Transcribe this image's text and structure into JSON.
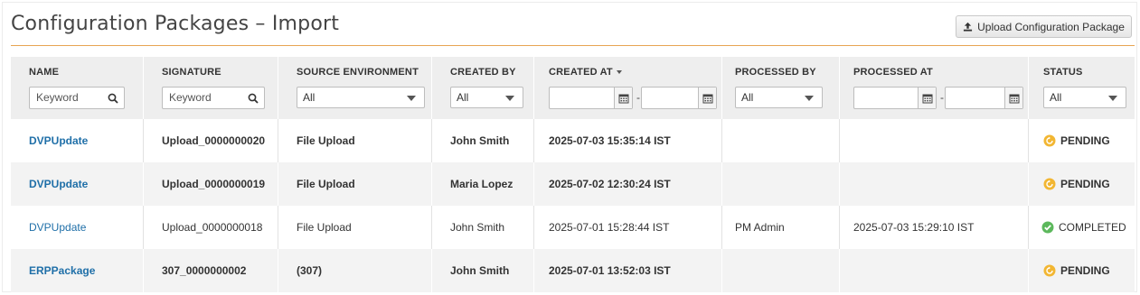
{
  "page": {
    "title": "Configuration Packages – Import",
    "upload_button_label": "Upload Configuration Package"
  },
  "columns": [
    {
      "label": "NAME"
    },
    {
      "label": "SIGNATURE"
    },
    {
      "label": "SOURCE ENVIRONMENT"
    },
    {
      "label": "CREATED BY"
    },
    {
      "label": "CREATED AT"
    },
    {
      "label": "PROCESSED BY"
    },
    {
      "label": "PROCESSED AT"
    },
    {
      "label": "STATUS"
    }
  ],
  "filters": {
    "name_placeholder": "Keyword",
    "signature_placeholder": "Keyword",
    "source_environment": "All",
    "created_by": "All",
    "processed_by": "All",
    "status": "All",
    "date_separator": "-"
  },
  "colors": {
    "link": "#1f6fa8",
    "accent_rule": "#e8a552",
    "pending": "#f2b632",
    "completed": "#5cb85c"
  },
  "rows": [
    {
      "name": "DVPUpdate",
      "signature": "Upload_0000000020",
      "source": "File Upload",
      "created_by": "John Smith",
      "created_at": "2025-07-03 15:35:14 IST",
      "processed_by": "",
      "processed_at": "",
      "status": "PENDING",
      "status_icon": "pending-icon",
      "bold": true
    },
    {
      "name": "DVPUpdate",
      "signature": "Upload_0000000019",
      "source": "File Upload",
      "created_by": "Maria Lopez",
      "created_at": "2025-07-02 12:30:24 IST",
      "processed_by": "",
      "processed_at": "",
      "status": "PENDING",
      "status_icon": "pending-icon",
      "bold": true
    },
    {
      "name": "DVPUpdate",
      "signature": "Upload_0000000018",
      "source": "File Upload",
      "created_by": "John Smith",
      "created_at": "2025-07-01 15:28:44 IST",
      "processed_by": "PM Admin",
      "processed_at": "2025-07-03 15:29:10 IST",
      "status": "COMPLETED",
      "status_icon": "check-circle-icon",
      "bold": false
    },
    {
      "name": "ERPPackage",
      "signature": "307_0000000002",
      "source": "(307)",
      "created_by": "John Smith",
      "created_at": "2025-07-01 13:52:03 IST",
      "processed_by": "",
      "processed_at": "",
      "status": "PENDING",
      "status_icon": "pending-icon",
      "bold": true
    }
  ]
}
